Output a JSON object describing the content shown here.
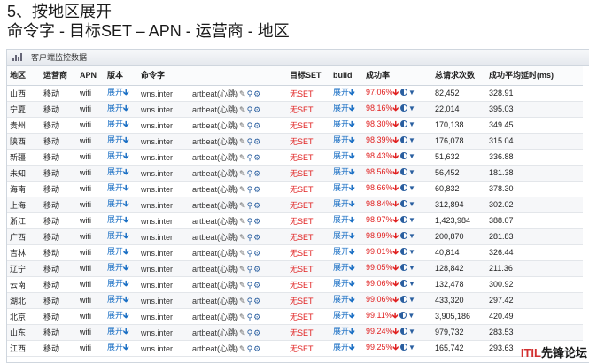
{
  "slide": {
    "title": "5、按地区展开",
    "subtitle": "命令字 - 目标SET – APN - 运营商 - 地区"
  },
  "panel": {
    "title": "客户端监控数据"
  },
  "table": {
    "columns": [
      "地区",
      "运营商",
      "APN",
      "版本",
      "命令字",
      "目标SET",
      "build",
      "成功率",
      "总请求次数",
      "成功平均延时(ms)"
    ],
    "expand_label": "展开",
    "noset_label": "无SET",
    "cmd_prefix": "wns.inter",
    "cmd_suffix": "artbeat(心跳)",
    "rows": [
      {
        "region": "山西",
        "carrier": "移动",
        "apn": "wifi",
        "rate": "97.06%",
        "requests": "82,452",
        "latency": "328.91"
      },
      {
        "region": "宁夏",
        "carrier": "移动",
        "apn": "wifi",
        "rate": "98.16%",
        "requests": "22,014",
        "latency": "395.03"
      },
      {
        "region": "贵州",
        "carrier": "移动",
        "apn": "wifi",
        "rate": "98.30%",
        "requests": "170,138",
        "latency": "349.45"
      },
      {
        "region": "陕西",
        "carrier": "移动",
        "apn": "wifi",
        "rate": "98.39%",
        "requests": "176,078",
        "latency": "315.04"
      },
      {
        "region": "新疆",
        "carrier": "移动",
        "apn": "wifi",
        "rate": "98.43%",
        "requests": "51,632",
        "latency": "336.88"
      },
      {
        "region": "未知",
        "carrier": "移动",
        "apn": "wifi",
        "rate": "98.56%",
        "requests": "56,452",
        "latency": "181.38"
      },
      {
        "region": "海南",
        "carrier": "移动",
        "apn": "wifi",
        "rate": "98.66%",
        "requests": "60,832",
        "latency": "378.30"
      },
      {
        "region": "上海",
        "carrier": "移动",
        "apn": "wifi",
        "rate": "98.84%",
        "requests": "312,894",
        "latency": "302.02"
      },
      {
        "region": "浙江",
        "carrier": "移动",
        "apn": "wifi",
        "rate": "98.97%",
        "requests": "1,423,984",
        "latency": "388.07"
      },
      {
        "region": "广西",
        "carrier": "移动",
        "apn": "wifi",
        "rate": "98.99%",
        "requests": "200,870",
        "latency": "281.83"
      },
      {
        "region": "吉林",
        "carrier": "移动",
        "apn": "wifi",
        "rate": "99.01%",
        "requests": "40,814",
        "latency": "326.44"
      },
      {
        "region": "辽宁",
        "carrier": "移动",
        "apn": "wifi",
        "rate": "99.05%",
        "requests": "128,842",
        "latency": "211.36"
      },
      {
        "region": "云南",
        "carrier": "移动",
        "apn": "wifi",
        "rate": "99.06%",
        "requests": "132,478",
        "latency": "300.92"
      },
      {
        "region": "湖北",
        "carrier": "移动",
        "apn": "wifi",
        "rate": "99.06%",
        "requests": "433,320",
        "latency": "297.42"
      },
      {
        "region": "北京",
        "carrier": "移动",
        "apn": "wifi",
        "rate": "99.11%",
        "requests": "3,905,186",
        "latency": "420.49"
      },
      {
        "region": "山东",
        "carrier": "移动",
        "apn": "wifi",
        "rate": "99.24%",
        "requests": "979,732",
        "latency": "283.53"
      },
      {
        "region": "江西",
        "carrier": "移动",
        "apn": "wifi",
        "rate": "99.25%",
        "requests": "165,742",
        "latency": "293.63"
      }
    ]
  },
  "watermark": {
    "part1": "ITIL",
    "part2": "先锋论坛"
  },
  "colors": {
    "link": "#1a6fc4",
    "alert": "#e02020"
  },
  "icons": {
    "expand": "down-arrow-icon",
    "rate_trend": "red-down-arrow-icon",
    "edit": "pencil-icon",
    "search": "search-icon",
    "settings": "gear-icon",
    "chart": "half-circle-icon",
    "filter": "filter-icon"
  }
}
